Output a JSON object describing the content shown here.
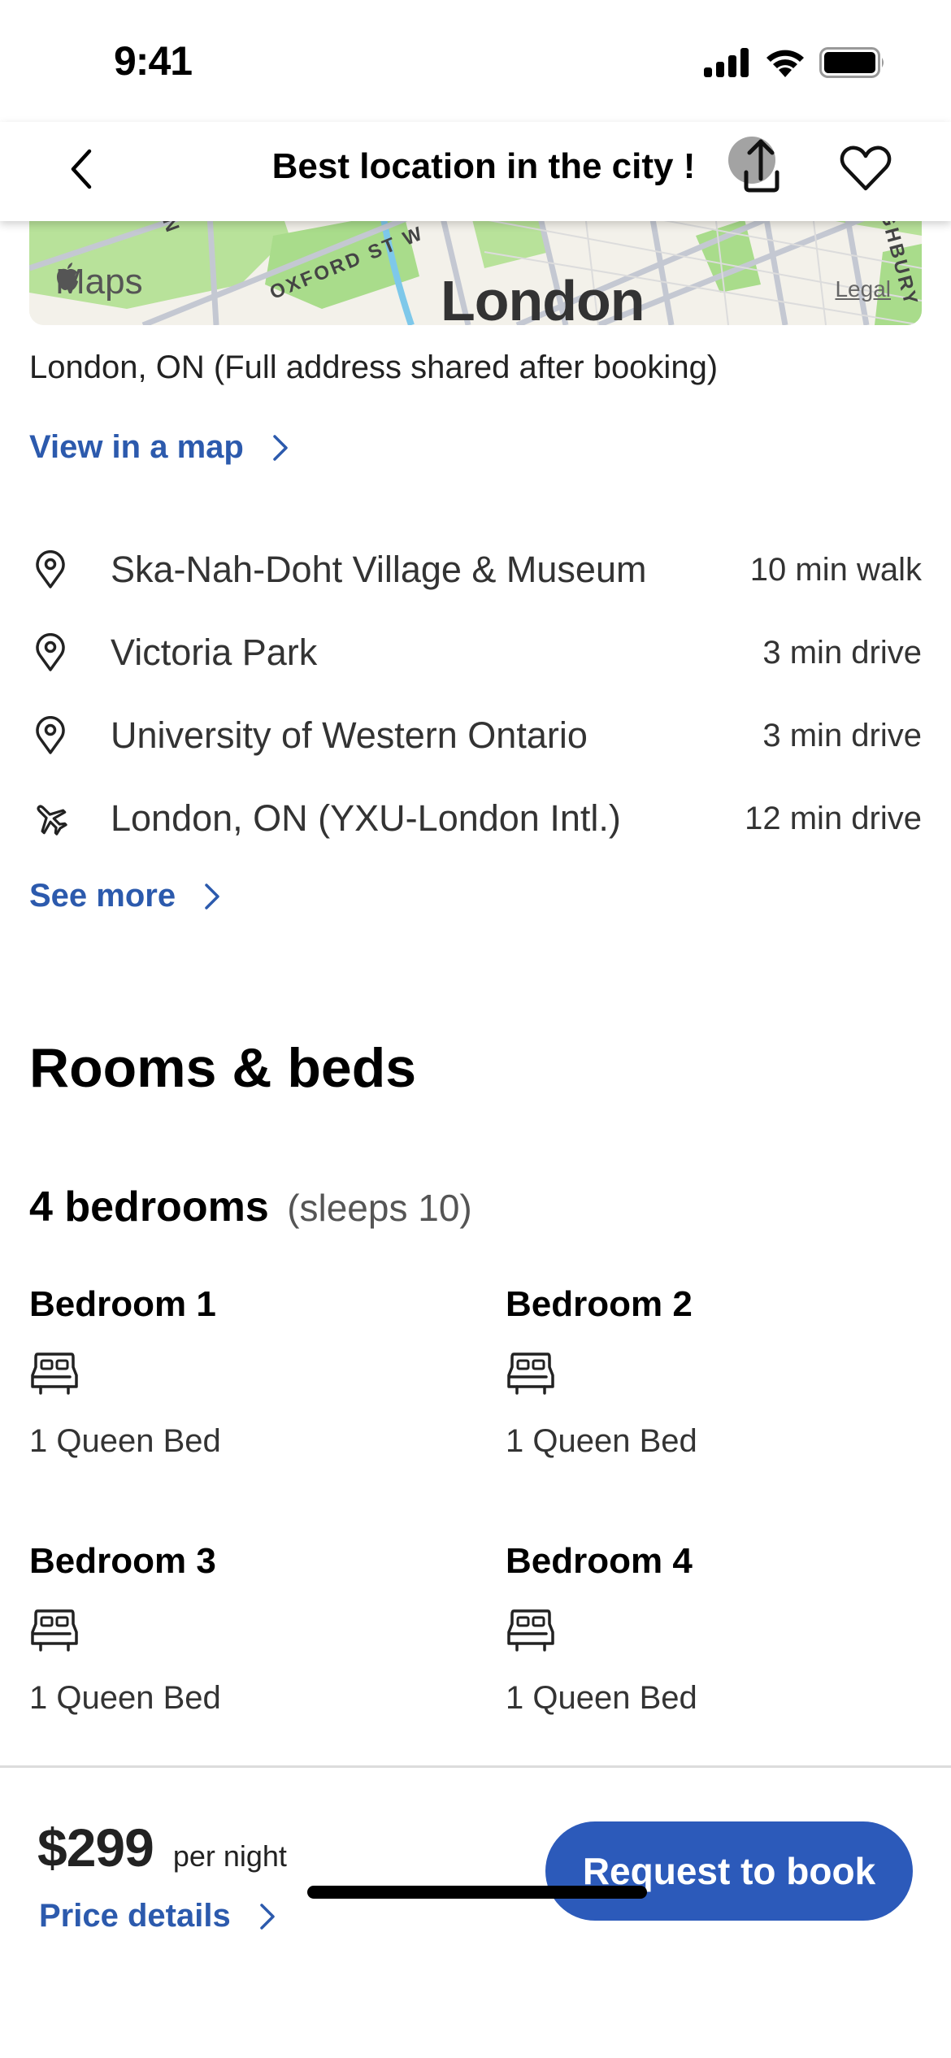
{
  "status_bar": {
    "time": "9:41",
    "icons": [
      "cellular-signal-icon",
      "wifi-icon",
      "battery-icon"
    ]
  },
  "nav": {
    "back_icon": "chevron-left-icon",
    "title": "Best location in the city !",
    "share_icon": "share-icon",
    "favorite_icon": "heart-icon"
  },
  "map": {
    "provider_label": "Maps",
    "city_label": "London",
    "legal_label": "Legal",
    "street_labels": [
      "OXFORD ST W",
      "RD N",
      "HIGHBURY"
    ],
    "colors": {
      "park": "#a9dc8b",
      "road": "#c4c8d2",
      "water": "#7ec8ea",
      "land": "#f3f1ea"
    }
  },
  "location": {
    "address": "London, ON (Full address shared after booking)",
    "view_map_label": "View in a map",
    "points_of_interest": [
      {
        "icon": "map-pin-icon",
        "name": "Ska-Nah-Doht Village & Museum",
        "time": "10 min walk"
      },
      {
        "icon": "map-pin-icon",
        "name": "Victoria Park",
        "time": "3 min drive"
      },
      {
        "icon": "map-pin-icon",
        "name": "University of Western Ontario",
        "time": "3 min drive"
      },
      {
        "icon": "airplane-icon",
        "name": "London, ON (YXU-London Intl.)",
        "time": "12 min drive"
      }
    ],
    "see_more_label": "See more"
  },
  "rooms": {
    "heading": "Rooms & beds",
    "summary": "4 bedrooms",
    "sleeps": "(sleeps 10)",
    "bedrooms": [
      {
        "title": "Bedroom 1",
        "beds": "1 Queen Bed"
      },
      {
        "title": "Bedroom 2",
        "beds": "1 Queen Bed"
      },
      {
        "title": "Bedroom 3",
        "beds": "1 Queen Bed"
      },
      {
        "title": "Bedroom 4",
        "beds": "1 Queen Bed"
      }
    ]
  },
  "booking": {
    "price": "$299",
    "price_unit": "per night",
    "price_details_label": "Price details",
    "cta_label": "Request to book",
    "accent_color": "#2c5aba",
    "link_color": "#2c5aad"
  }
}
